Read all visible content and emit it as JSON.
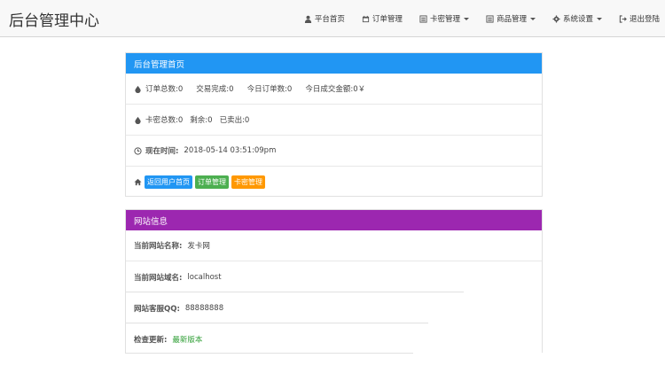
{
  "header": {
    "brand": "后台管理中心",
    "nav": [
      {
        "label": "平台首页",
        "icon": "user-icon",
        "dropdown": false
      },
      {
        "label": "订单管理",
        "icon": "calendar-icon",
        "dropdown": false
      },
      {
        "label": "卡密管理",
        "icon": "list-icon",
        "dropdown": true
      },
      {
        "label": "商品管理",
        "icon": "list-icon",
        "dropdown": true
      },
      {
        "label": "系统设置",
        "icon": "gear-icon",
        "dropdown": true
      },
      {
        "label": "退出登陆",
        "icon": "logout-icon",
        "dropdown": false
      }
    ]
  },
  "home_panel": {
    "title": "后台管理首页",
    "orders": {
      "total": "订单总数:0",
      "completed": "交易完成:0",
      "today_orders": "今日订单数:0",
      "today_amount": "今日成交金额:0￥"
    },
    "cards": {
      "total": "卡密总数:0",
      "remaining": "剩余:0",
      "sold": "已卖出:0"
    },
    "time": {
      "label": "现在时间:",
      "value": "2018-05-14 03:51:09pm"
    },
    "links": [
      "返回用户首页",
      "订单管理",
      "卡密管理"
    ]
  },
  "site_panel": {
    "title": "网站信息",
    "name_label": "当前网站名称:",
    "name_value": "发卡网",
    "domain_label": "当前网站域名:",
    "domain_value": "localhost",
    "qq_label": "网站客服QQ:",
    "qq_value": "88888888",
    "update_label": "检查更新:",
    "update_value": "最新版本"
  }
}
